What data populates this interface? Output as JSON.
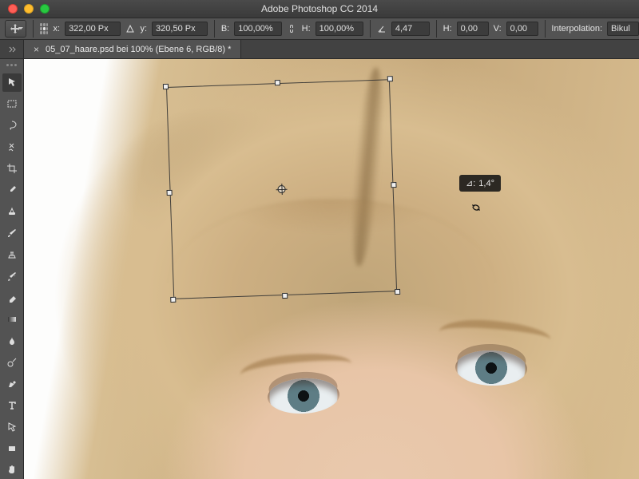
{
  "titlebar": {
    "app_title": "Adobe Photoshop CC 2014"
  },
  "options": {
    "x_label": "x:",
    "x_value": "322,00 Px",
    "y_label": "y:",
    "y_value": "320,50 Px",
    "w_label": "B:",
    "w_value": "100,00%",
    "h_label": "H:",
    "h_value": "100,00%",
    "angle_value": "4,47",
    "skew_h_label": "H:",
    "skew_h_value": "0,00",
    "skew_v_label": "V:",
    "skew_v_value": "0,00",
    "interp_label": "Interpolation:",
    "interp_value": "Bikul"
  },
  "tab": {
    "title": "05_07_haare.psd bei 100% (Ebene 6, RGB/8) *",
    "close": "×"
  },
  "tooltip": {
    "angle_label": "⊿:",
    "angle_value": "1,4°"
  },
  "tools": {
    "move": "move-tool",
    "marquee": "rectangular-marquee-tool",
    "lasso": "lasso-tool",
    "wand": "quick-selection-tool",
    "crop": "crop-tool",
    "eyedrop": "eyedropper-tool",
    "heal": "spot-healing-brush-tool",
    "brush": "brush-tool",
    "stamp": "clone-stamp-tool",
    "history": "history-brush-tool",
    "eraser": "eraser-tool",
    "gradient": "gradient-tool",
    "blur": "blur-tool",
    "dodge": "dodge-tool",
    "pen": "pen-tool",
    "type": "type-tool",
    "path": "path-selection-tool",
    "shape": "rectangle-tool",
    "hand": "hand-tool"
  }
}
